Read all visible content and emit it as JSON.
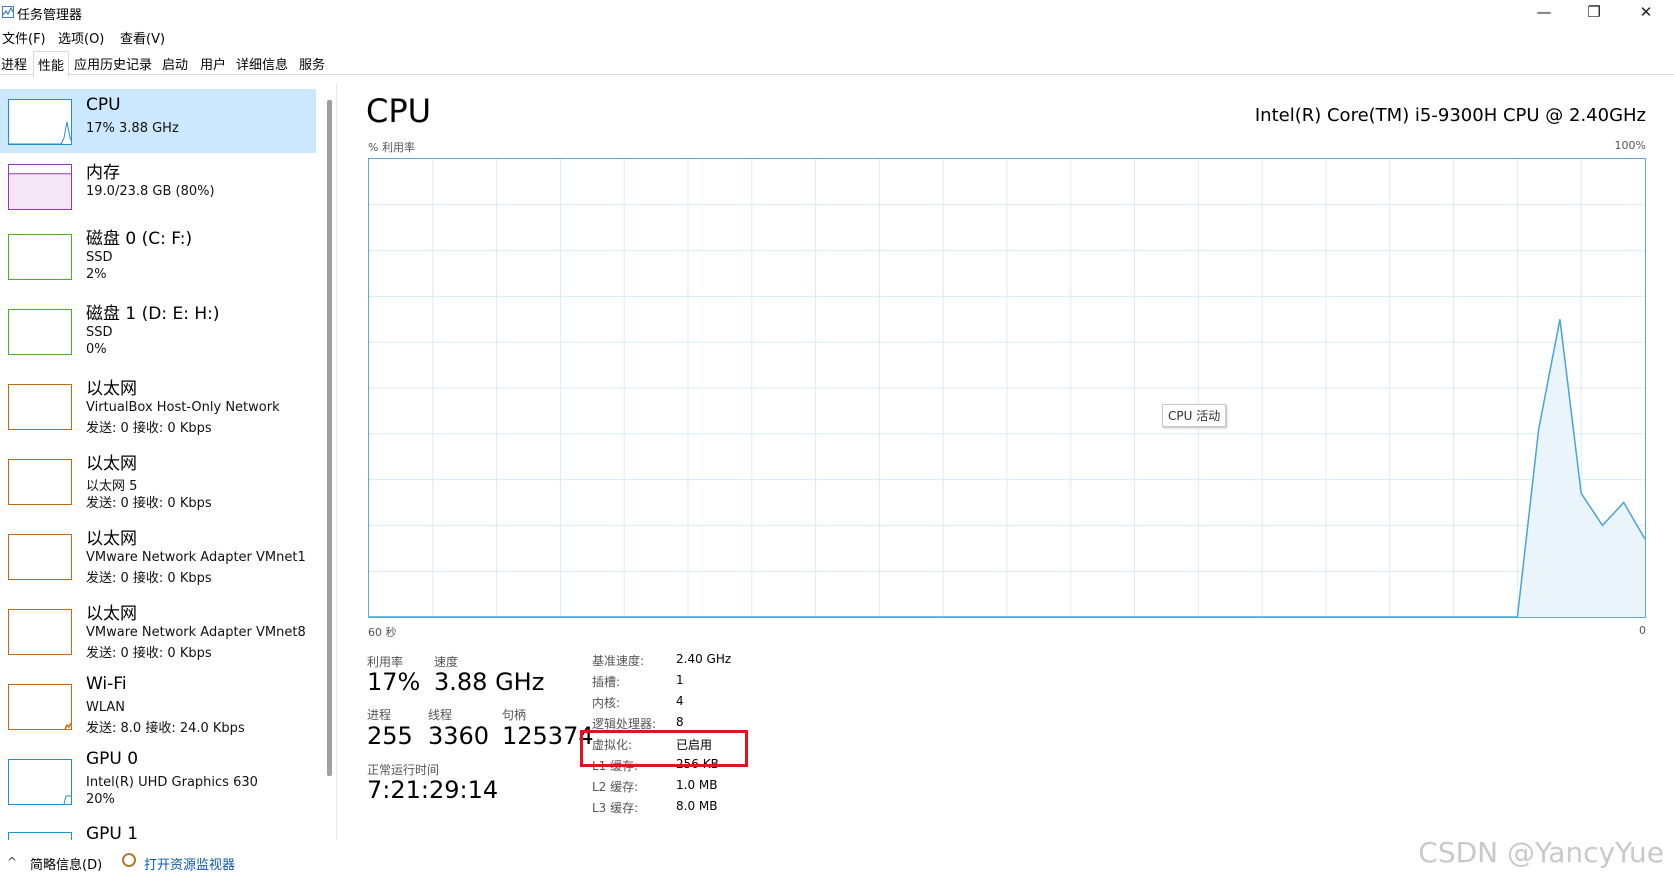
{
  "window": {
    "title": "任务管理器",
    "minimize": "—",
    "restore": "❐",
    "close": "✕"
  },
  "menu": [
    "文件(F)",
    "选项(O)",
    "查看(V)"
  ],
  "tabs": [
    "进程",
    "性能",
    "应用历史记录",
    "启动",
    "用户",
    "详细信息",
    "服务"
  ],
  "active_tab": "性能",
  "sidebar": [
    {
      "title": "CPU",
      "lines": [
        "17% 3.88 GHz"
      ],
      "color": "#1f8fd1",
      "selected": true,
      "usage": 0.17
    },
    {
      "title": "内存",
      "lines": [
        "19.0/23.8 GB (80%)"
      ],
      "color": "#9b36b7",
      "usage": 0.8
    },
    {
      "title": "磁盘 0 (C: F:)",
      "lines": [
        "SSD",
        "2%"
      ],
      "color": "#4caf2c",
      "usage": 0.02
    },
    {
      "title": "磁盘 1 (D: E: H:)",
      "lines": [
        "SSD",
        "0%"
      ],
      "color": "#4caf2c",
      "usage": 0.0
    },
    {
      "title": "以太网",
      "lines": [
        "VirtualBox Host-Only Network",
        "发送: 0 接收: 0 Kbps"
      ],
      "color": "#c46a15"
    },
    {
      "title": "以太网",
      "lines": [
        "以太网 5",
        "发送: 0 接收: 0 Kbps"
      ],
      "color": "#c46a15"
    },
    {
      "title": "以太网",
      "lines": [
        "VMware Network Adapter VMnet1",
        "发送: 0 接收: 0 Kbps"
      ],
      "color": "#c46a15"
    },
    {
      "title": "以太网",
      "lines": [
        "VMware Network Adapter VMnet8",
        "发送: 0 接收: 0 Kbps"
      ],
      "color": "#c46a15"
    },
    {
      "title": "Wi-Fi",
      "lines": [
        "WLAN",
        "发送: 8.0 接收: 24.0 Kbps"
      ],
      "color": "#c46a15"
    },
    {
      "title": "GPU 0",
      "lines": [
        "Intel(R) UHD Graphics 630",
        "20%"
      ],
      "color": "#1f8fd1"
    },
    {
      "title": "GPU 1",
      "lines": [],
      "color": "#1f8fd1"
    }
  ],
  "main": {
    "title": "CPU",
    "model": "Intel(R) Core(TM) i5-9300H CPU @ 2.40GHz",
    "y_label": "% 利用率",
    "y_max": "100%",
    "x_left": "60 秒",
    "x_right": "0",
    "tooltip": "CPU 活动"
  },
  "chart_data": {
    "type": "area",
    "x": [
      60,
      57,
      54,
      51,
      48,
      45,
      42,
      39,
      36,
      33,
      30,
      27,
      24,
      21,
      18,
      15,
      12,
      9,
      6,
      5,
      4,
      3,
      2,
      1,
      0
    ],
    "values": [
      0,
      0,
      0,
      0,
      0,
      0,
      0,
      0,
      0,
      0,
      0,
      0,
      0,
      0,
      0,
      0,
      0,
      0,
      0,
      41,
      65,
      27,
      20,
      25,
      17
    ],
    "ylim": [
      0,
      100
    ],
    "xlim": [
      60,
      0
    ],
    "grid": true,
    "line_color": "#4aa3d8",
    "fill_color": "#eaf4fb"
  },
  "stats": {
    "utilization_label": "利用率",
    "utilization": "17%",
    "speed_label": "速度",
    "speed": "3.88 GHz",
    "processes_label": "进程",
    "processes": "255",
    "threads_label": "线程",
    "threads": "3360",
    "handles_label": "句柄",
    "handles": "125374",
    "uptime_label": "正常运行时间",
    "uptime": "7:21:29:14"
  },
  "specs": [
    {
      "key": "基准速度:",
      "value": "2.40 GHz"
    },
    {
      "key": "插槽:",
      "value": "1"
    },
    {
      "key": "内核:",
      "value": "4"
    },
    {
      "key": "逻辑处理器:",
      "value": "8"
    },
    {
      "key": "虚拟化:",
      "value": "已启用"
    },
    {
      "key": "L1 缓存:",
      "value": "256 KB"
    },
    {
      "key": "L2 缓存:",
      "value": "1.0 MB"
    },
    {
      "key": "L3 缓存:",
      "value": "8.0 MB"
    }
  ],
  "footer": {
    "chevron": "^",
    "summary": "简略信息(D)",
    "monitor_link": "打开资源监视器"
  },
  "watermark": "CSDN @YancyYue"
}
